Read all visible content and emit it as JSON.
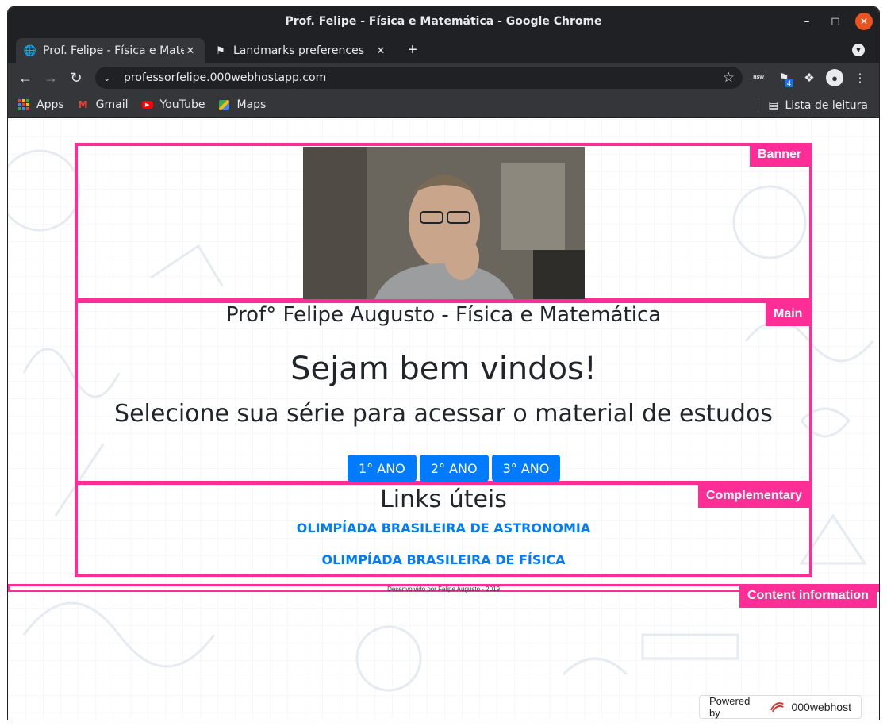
{
  "window": {
    "title": "Prof. Felipe - Física e Matemática - Google Chrome"
  },
  "tabs": [
    {
      "label": "Prof. Felipe - Física e Matemática",
      "icon": "globe-icon",
      "active": true
    },
    {
      "label": "Landmarks preferences",
      "icon": "flag-icon",
      "active": false
    }
  ],
  "toolbar": {
    "url": "professorfelipe.000webhostapp.com",
    "extension_badge": "4",
    "nsw_label": "nsw"
  },
  "bookmarks": [
    {
      "label": "Apps",
      "icon": "apps-grid-icon"
    },
    {
      "label": "Gmail",
      "icon": "gmail-icon"
    },
    {
      "label": "YouTube",
      "icon": "youtube-icon"
    },
    {
      "label": "Maps",
      "icon": "maps-icon"
    }
  ],
  "reading_list": {
    "label": "Lista de leitura"
  },
  "landmarks": {
    "banner": "Banner",
    "main": "Main",
    "complementary": "Complementary",
    "contentinfo": "Content information"
  },
  "page": {
    "site_title": "Prof° Felipe Augusto - Física e Matemática",
    "welcome": "Sejam bem vindos!",
    "select_text": "Selecione sua série para acessar o material de estudos",
    "buttons": [
      "1° ANO",
      "2° ANO",
      "3° ANO"
    ],
    "links_title": "Links úteis",
    "links": [
      "OLIMPÍADA BRASILEIRA DE ASTRONOMIA",
      "OLIMPÍADA BRASILEIRA DE FÍSICA"
    ],
    "footer": "Desenvolvido por Felipe Augusto - 2019"
  },
  "powered": {
    "prefix": "Powered by",
    "brand": "000webhost"
  },
  "colors": {
    "landmark": "#ff2d95",
    "button": "#007bff",
    "chrome_dark": "#202124",
    "chrome_toolbar": "#35363a"
  }
}
